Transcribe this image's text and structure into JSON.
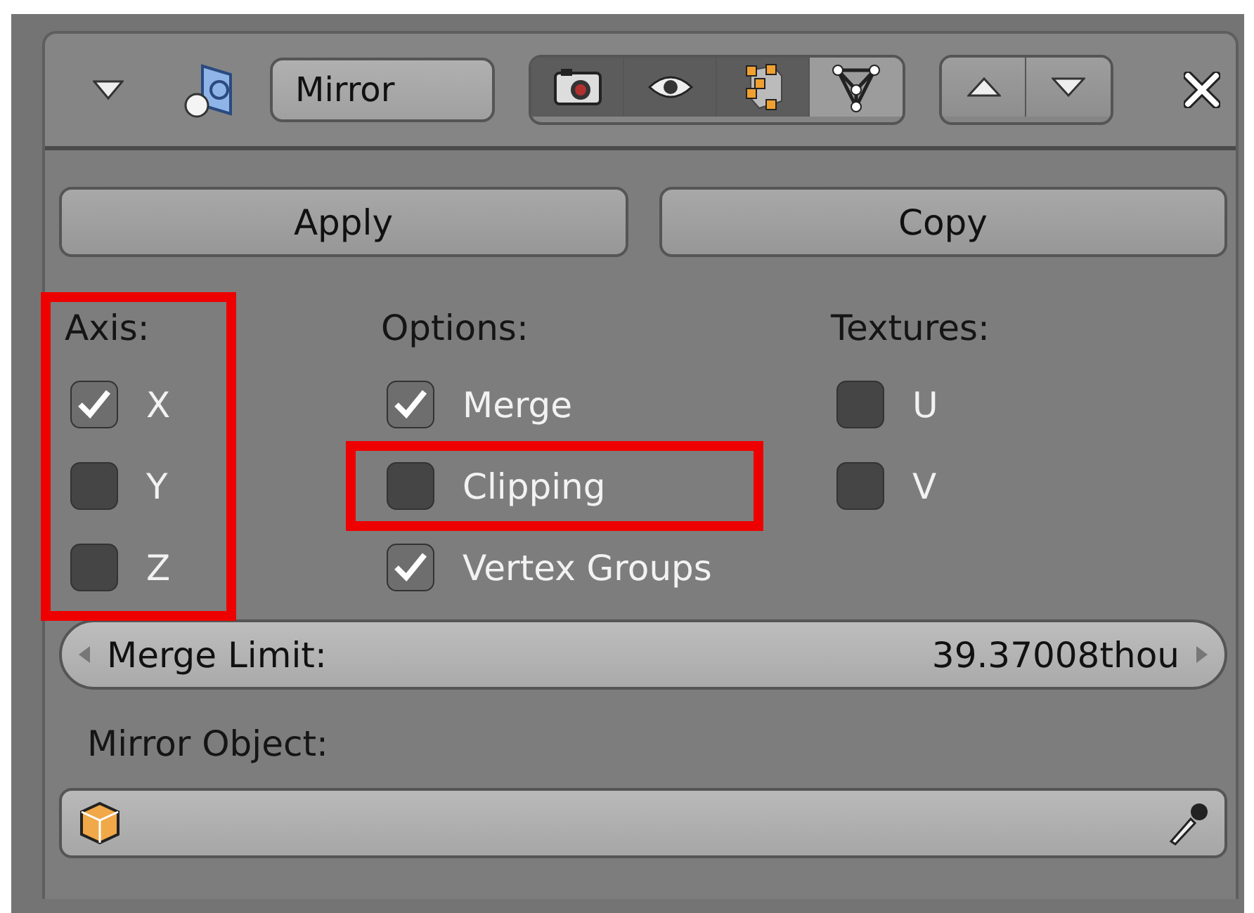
{
  "header": {
    "name": "Mirror",
    "toggles": [
      {
        "kind": "render",
        "selected": true
      },
      {
        "kind": "viewport",
        "selected": true
      },
      {
        "kind": "editmode",
        "selected": true
      },
      {
        "kind": "cage",
        "selected": false
      }
    ]
  },
  "buttons": [
    "Apply",
    "Copy"
  ],
  "columns": [
    {
      "heading": "Axis:",
      "highlighted": true,
      "items": [
        {
          "label": "X",
          "checked": true,
          "highlighted": false
        },
        {
          "label": "Y",
          "checked": false,
          "highlighted": false
        },
        {
          "label": "Z",
          "checked": false,
          "highlighted": false
        }
      ]
    },
    {
      "heading": "Options:",
      "highlighted": false,
      "items": [
        {
          "label": "Merge",
          "checked": true,
          "highlighted": false
        },
        {
          "label": "Clipping",
          "checked": false,
          "highlighted": true
        },
        {
          "label": "Vertex Groups",
          "checked": true,
          "highlighted": false
        }
      ]
    },
    {
      "heading": "Textures:",
      "highlighted": false,
      "items": [
        {
          "label": "U",
          "checked": false,
          "highlighted": false
        },
        {
          "label": "V",
          "checked": false,
          "highlighted": false
        }
      ]
    }
  ],
  "merge_limit": {
    "label": "Merge Limit:",
    "value": "39.37008thou"
  },
  "mirror_object": {
    "label": "Mirror Object:"
  }
}
